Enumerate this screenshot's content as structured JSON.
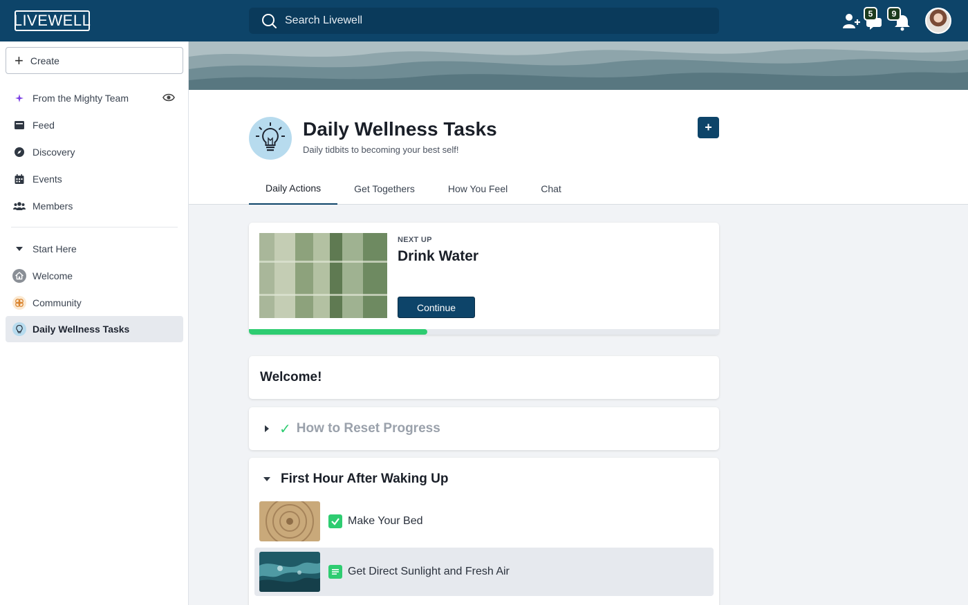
{
  "app": {
    "logo": "LIVEWELL"
  },
  "search": {
    "placeholder": "Search Livewell"
  },
  "notifications": {
    "messages_count": "5",
    "alerts_count": "9"
  },
  "sidebar": {
    "create_label": "Create",
    "items": [
      {
        "label": "From the Mighty Team",
        "icon": "sparkle-icon"
      },
      {
        "label": "Feed",
        "icon": "feed-icon"
      },
      {
        "label": "Discovery",
        "icon": "compass-icon"
      },
      {
        "label": "Events",
        "icon": "calendar-icon"
      },
      {
        "label": "Members",
        "icon": "members-icon"
      }
    ],
    "section": {
      "label": "Start Here",
      "items": [
        {
          "label": "Welcome",
          "icon": "house-icon"
        },
        {
          "label": "Community",
          "icon": "community-icon"
        },
        {
          "label": "Daily Wellness Tasks",
          "icon": "lightbulb-icon",
          "active": true
        }
      ]
    }
  },
  "group": {
    "title": "Daily Wellness Tasks",
    "subtitle": "Daily tidbits to becoming your best self!",
    "tabs": [
      {
        "label": "Daily Actions",
        "active": true
      },
      {
        "label": "Get Togethers"
      },
      {
        "label": "How You Feel"
      },
      {
        "label": "Chat"
      }
    ]
  },
  "next_up": {
    "label": "NEXT UP",
    "title": "Drink Water",
    "button_label": "Continue",
    "progress_fraction": 0.38
  },
  "sections": {
    "welcome": "Welcome!",
    "reset": "How to Reset Progress",
    "first_hour": {
      "title": "First Hour After Waking Up",
      "lessons": [
        {
          "label": "Make Your Bed",
          "status": "completed"
        },
        {
          "label": "Get Direct Sunlight and Fresh Air",
          "status": "in-progress"
        }
      ]
    }
  },
  "colors": {
    "brand": "#0d4469",
    "accent_green": "#2ecc71",
    "active_bg": "#e6e9ee"
  }
}
